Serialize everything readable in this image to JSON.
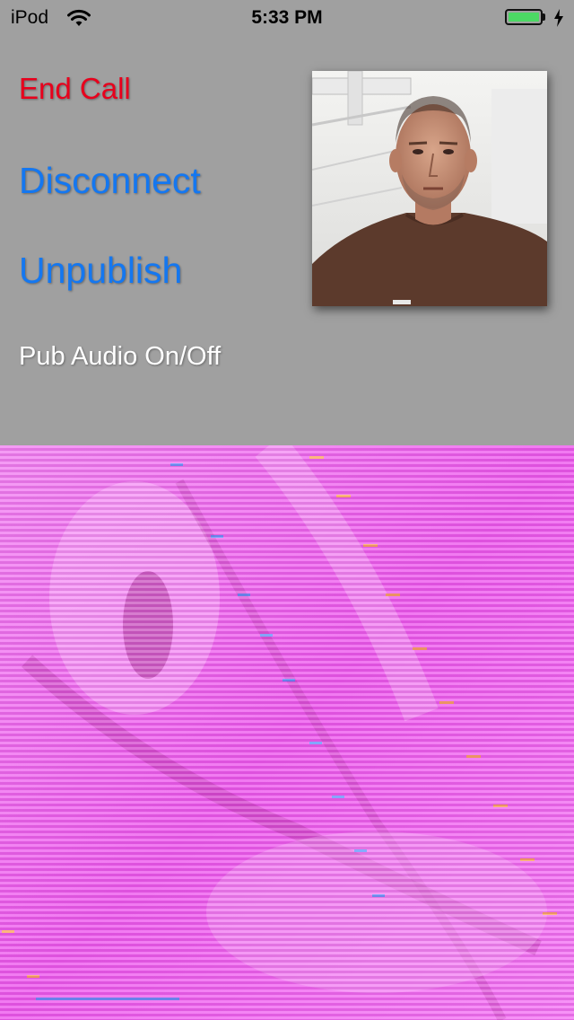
{
  "status_bar": {
    "carrier": "iPod",
    "time": "5:33 PM",
    "wifi_icon": "wifi-icon",
    "battery_icon": "battery-icon",
    "battery_level": 1.0,
    "battery_color": "#4cd964",
    "charging_icon": "charging-bolt-icon"
  },
  "controls": {
    "end_call": "End Call",
    "disconnect": "Disconnect",
    "unpublish": "Unpublish",
    "pub_audio": "Pub Audio On/Off"
  },
  "colors": {
    "background": "#a0a0a0",
    "end_call": "#e8001c",
    "link": "#1477f0",
    "pub_audio": "#ffffff",
    "subscriber_tint": "#f06af0"
  },
  "media": {
    "publisher_view": "publisher-camera-preview",
    "subscriber_view": "subscriber-video-stream"
  }
}
